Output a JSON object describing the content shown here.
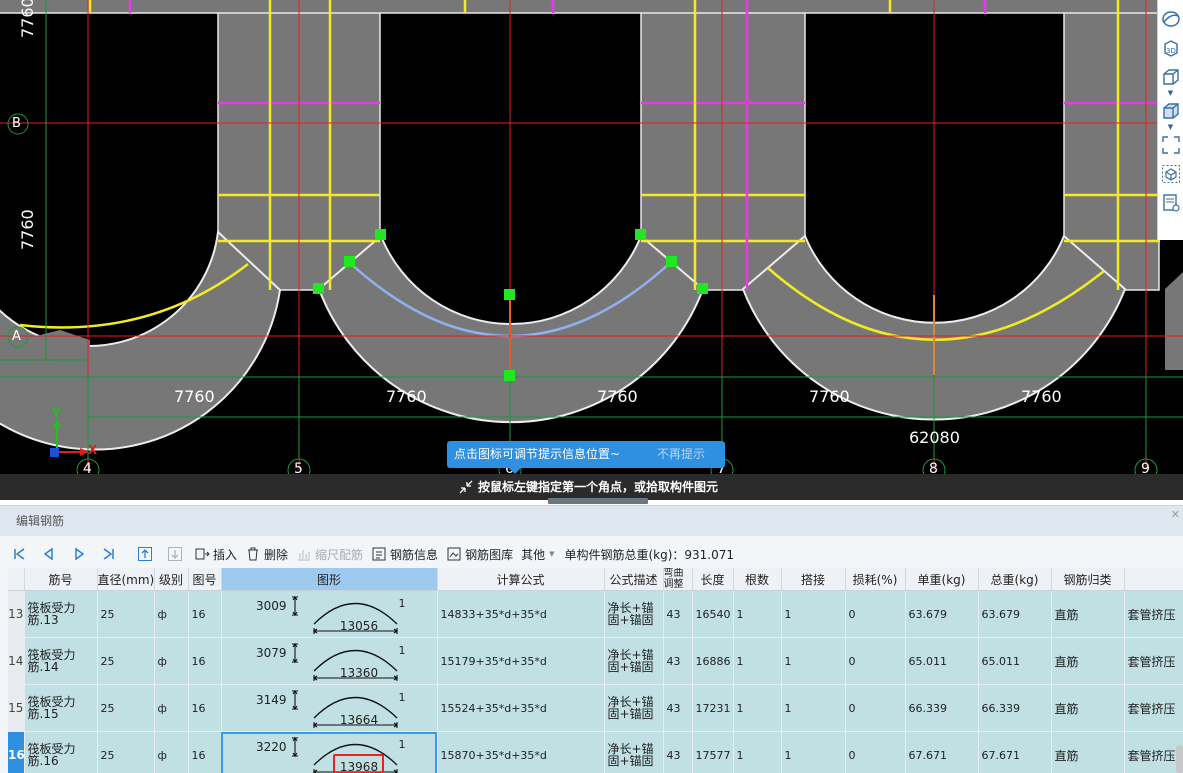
{
  "cad": {
    "dimension_labels": {
      "spans": [
        "7760",
        "7760",
        "7760",
        "7760",
        "7760"
      ],
      "total": "62080",
      "vertical_top": "7760",
      "vertical_mid": "7760"
    },
    "grid_axis_labels": [
      "4",
      "5",
      "6",
      "7",
      "8",
      "9"
    ],
    "row_axis_labels": [
      "B",
      "A"
    ],
    "axis_indicator": {
      "y": "Y",
      "x": "X"
    },
    "tip": {
      "message": "点击图标可调节提示信息位置~",
      "dismiss": "不再提示"
    },
    "command_prompt": "按鼠标左键指定第一个角点，或拾取构件图元",
    "right_toolbar": [
      "orbit-icon",
      "view-3d-icon",
      "cube-view-icon",
      "cube-shaded-icon",
      "zoom-extents-icon",
      "object-cube-icon",
      "report-view-icon"
    ]
  },
  "panel": {
    "title": "编辑钢筋",
    "toolbar": {
      "insert": "插入",
      "delete": "删除",
      "scale_config": "缩尺配筋",
      "rebar_info": "钢筋信息",
      "rebar_library": "钢筋图库",
      "other": "其他",
      "total_weight_label": "单构件钢筋总重(kg)：931.071"
    },
    "columns": [
      "筋号",
      "直径(mm)",
      "级别",
      "图号",
      "图形",
      "计算公式",
      "公式描述",
      "弯曲调整",
      "长度",
      "根数",
      "搭接",
      "损耗(%)",
      "单重(kg)",
      "总重(kg)",
      "钢筋归类",
      ""
    ],
    "rows": [
      {
        "num": "13",
        "name": "筏板受力筋.13",
        "dia": "25",
        "grade": "ф",
        "fig": "16",
        "rise": "3009",
        "span": "13056",
        "end": "1",
        "formula": "14833+35*d+35*d",
        "desc": "净长+锚固+锚固",
        "bend": "43",
        "length": "16540",
        "count": "1",
        "lap": "1",
        "loss": "0",
        "unit": "63.679",
        "total": "63.679",
        "cls": "直筋",
        "conn": "套管挤压"
      },
      {
        "num": "14",
        "name": "筏板受力筋.14",
        "dia": "25",
        "grade": "ф",
        "fig": "16",
        "rise": "3079",
        "span": "13360",
        "end": "1",
        "formula": "15179+35*d+35*d",
        "desc": "净长+锚固+锚固",
        "bend": "43",
        "length": "16886",
        "count": "1",
        "lap": "1",
        "loss": "0",
        "unit": "65.011",
        "total": "65.011",
        "cls": "直筋",
        "conn": "套管挤压"
      },
      {
        "num": "15",
        "name": "筏板受力筋.15",
        "dia": "25",
        "grade": "ф",
        "fig": "16",
        "rise": "3149",
        "span": "13664",
        "end": "1",
        "formula": "15524+35*d+35*d",
        "desc": "净长+锚固+锚固",
        "bend": "43",
        "length": "17231",
        "count": "1",
        "lap": "1",
        "loss": "0",
        "unit": "66.339",
        "total": "66.339",
        "cls": "直筋",
        "conn": "套管挤压"
      },
      {
        "num": "16",
        "name": "筏板受力筋.16",
        "dia": "25",
        "grade": "ф",
        "fig": "16",
        "rise": "3220",
        "span": "13968",
        "end": "1",
        "formula": "15870+35*d+35*d",
        "desc": "净长+锚固+锚固",
        "bend": "43",
        "length": "17577",
        "count": "1",
        "lap": "1",
        "loss": "0",
        "unit": "67.671",
        "total": "67.671",
        "cls": "直筋",
        "conn": "套管挤压"
      }
    ]
  },
  "colors": {
    "canvas": "#000000",
    "slab": "#777777",
    "grid_line": "#e02020",
    "rebar_yellow": "#f2ea22",
    "rebar_magenta": "#e83ae8",
    "selected_rebar": "#8fb1f0",
    "grip": "#22e622",
    "row_bg": "#c1e0e4",
    "accent": "#2f8fe0"
  }
}
